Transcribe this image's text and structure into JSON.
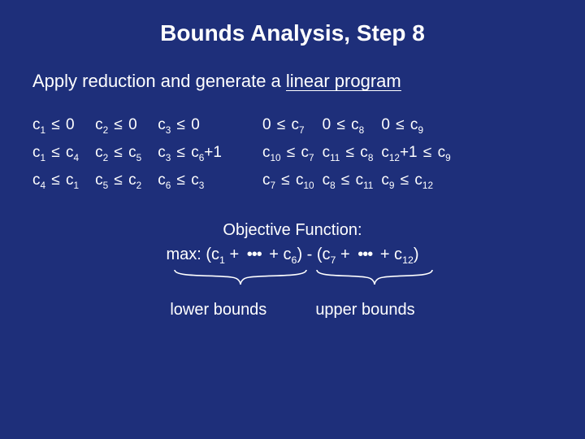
{
  "title": "Bounds Analysis, Step 8",
  "subtitle_a": "Apply reduction and generate a ",
  "subtitle_b": "linear program",
  "constraints": {
    "left": [
      [
        "c<sub>1</sub> ≤ 0",
        "c<sub>1</sub> ≤ c<sub>4</sub>",
        "c<sub>4</sub> ≤ c<sub>1</sub>"
      ],
      [
        "c<sub>2</sub> ≤ 0",
        "c<sub>2</sub> ≤ c<sub>5</sub>",
        "c<sub>5</sub> ≤ c<sub>2</sub>"
      ],
      [
        "c<sub>3</sub> ≤ 0",
        "c<sub>3</sub> ≤ c<sub>6</sub>+1",
        "c<sub>6</sub> ≤ c<sub>3</sub>"
      ]
    ],
    "right": [
      [
        "0 ≤ c<sub>7</sub>",
        "c<sub>10</sub> ≤ c<sub>7</sub>",
        "c<sub>7</sub> ≤ c<sub>10</sub>"
      ],
      [
        "0 ≤ c<sub>8</sub>",
        "c<sub>11</sub> ≤ c<sub>8</sub>",
        "c<sub>8</sub> ≤ c<sub>11</sub>"
      ],
      [
        "0 ≤ c<sub>9</sub>",
        "c<sub>12</sub>+1 ≤ c<sub>9</sub>",
        "c<sub>9</sub> ≤ c<sub>12</sub>"
      ]
    ]
  },
  "objective": {
    "heading": "Objective Function:",
    "formula": "max: (c<sub>1</sub> + ··· + c<sub>6</sub>) - (c<sub>7</sub> + ··· + c<sub>12</sub>)",
    "label_lower": "lower bounds",
    "label_upper": "upper bounds"
  }
}
